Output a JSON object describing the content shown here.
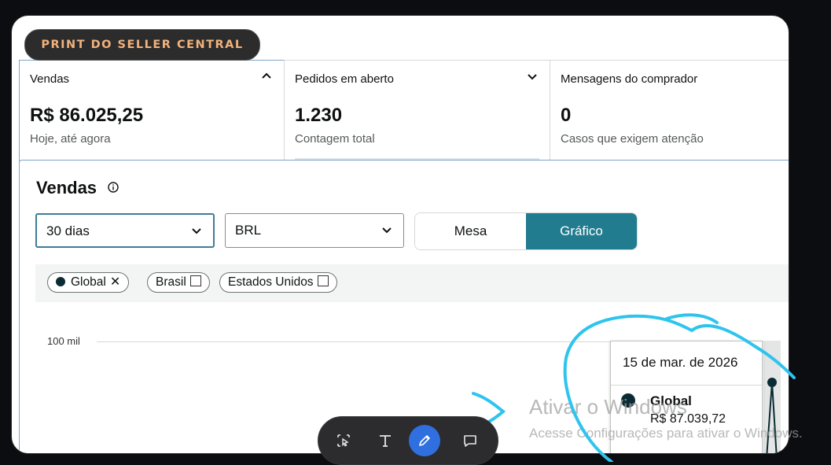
{
  "badge": "PRINT DO SELLER CENTRAL",
  "cards": [
    {
      "title": "Vendas",
      "value": "R$ 86.025,25",
      "sub": "Hoje, até agora",
      "chevron": "chevron-up-icon"
    },
    {
      "title": "Pedidos em aberto",
      "value": "1.230",
      "sub": "Contagem total",
      "chevron": "chevron-down-icon"
    },
    {
      "title": "Mensagens do comprador",
      "value": "0",
      "sub": "Casos que exigem atenção"
    }
  ],
  "panel": {
    "title": "Vendas",
    "period_select": "30 dias",
    "currency_select": "BRL",
    "view_toggle": {
      "options": [
        "Mesa",
        "Gráfico"
      ],
      "selected": "Gráfico"
    },
    "filters": [
      {
        "label": "Global",
        "active": true
      },
      {
        "label": "Brasil",
        "active": false
      },
      {
        "label": "Estados Unidos",
        "active": false
      }
    ],
    "axis_label": "100 mil",
    "tooltip": {
      "date": "15 de mar. de 2026",
      "series": "Global",
      "value": "R$ 87.039,72"
    }
  },
  "watermark": {
    "line1": "Ativar o Windows",
    "line2": "Acesse Configurações para ativar o Windows."
  },
  "colors": {
    "accent": "#227c8f",
    "series": "#0b2b34",
    "annotation": "#2ec4ee",
    "badge_text": "#f2b27c",
    "toolbar_active": "#2f6fe0"
  },
  "toolbar": {
    "tools": [
      "select-icon",
      "text-icon",
      "pen-icon",
      "comment-icon"
    ],
    "active": "pen-icon"
  }
}
